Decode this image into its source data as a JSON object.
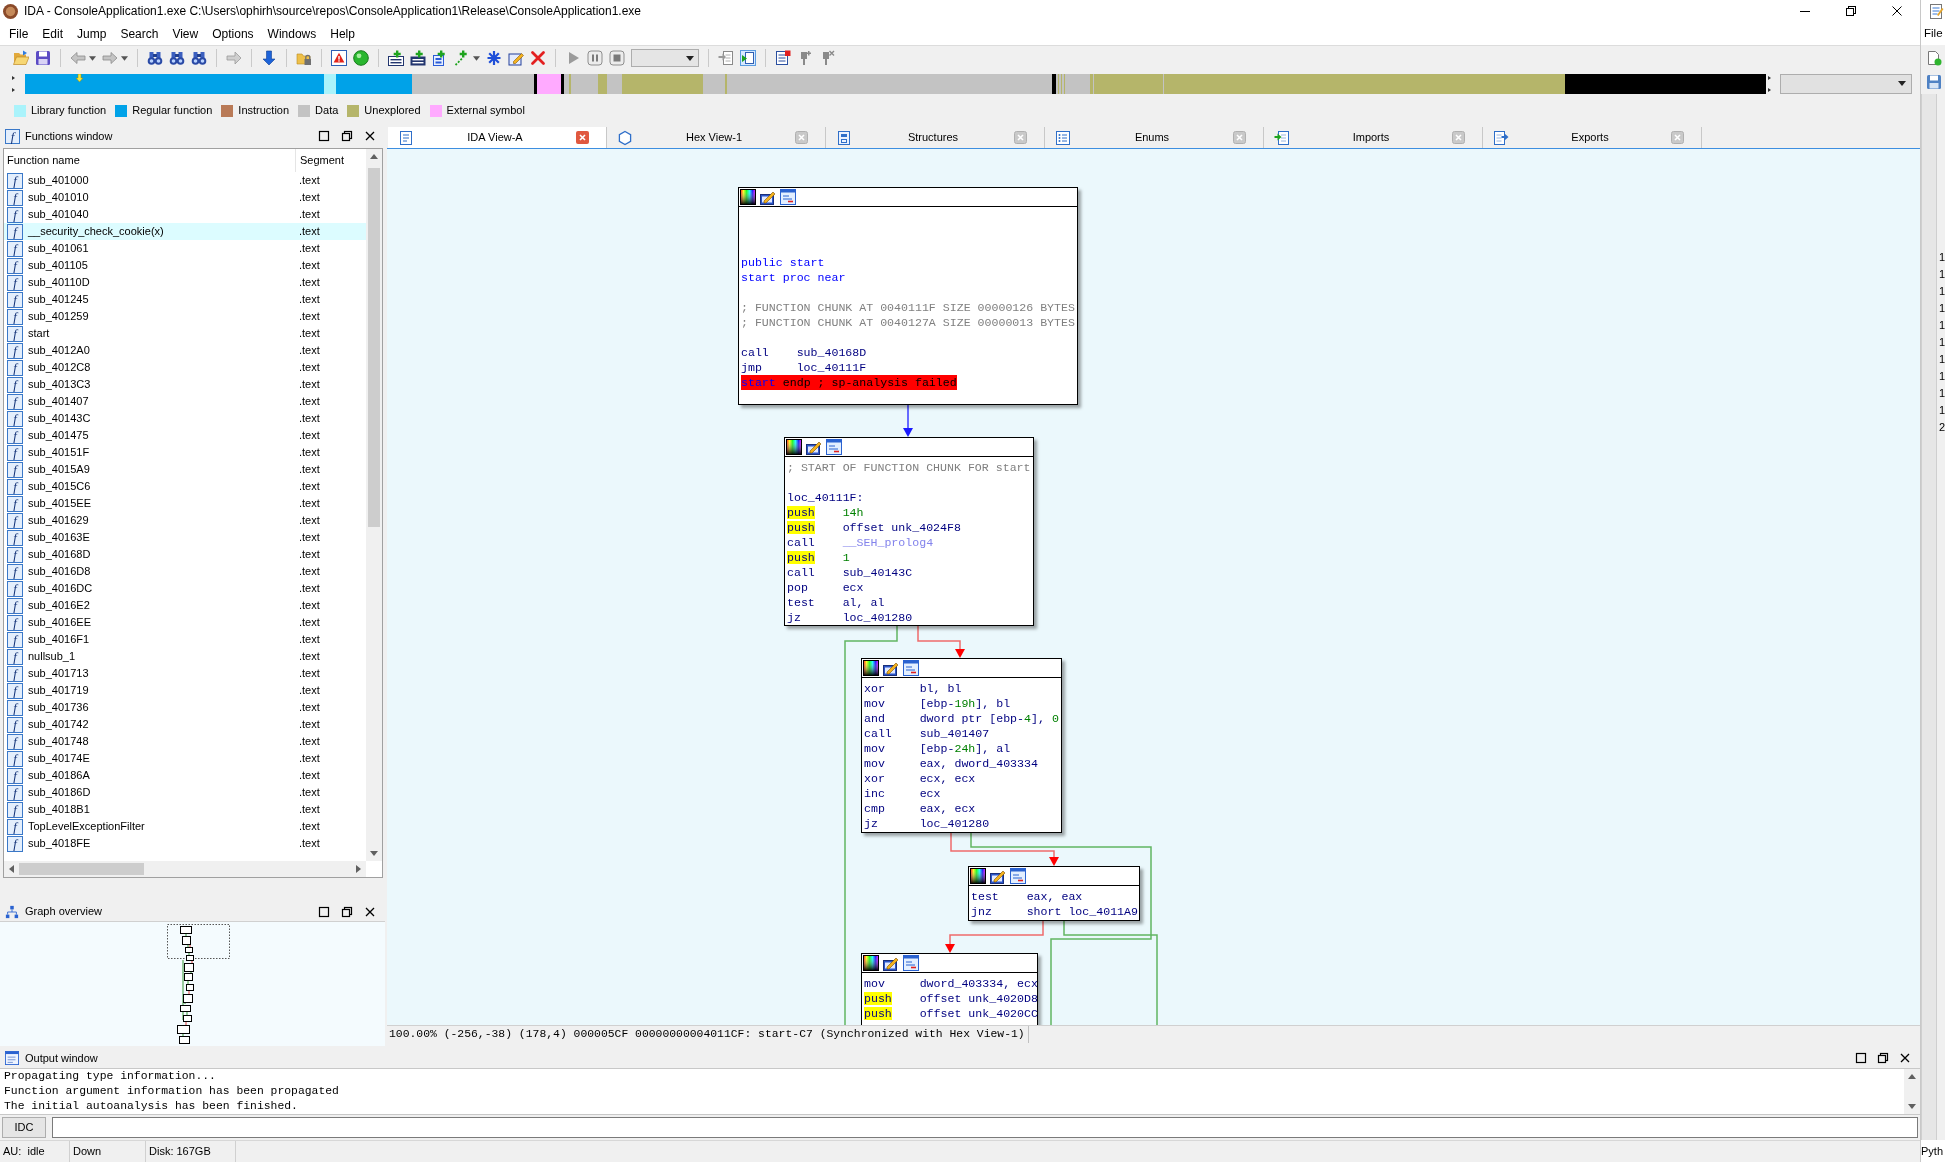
{
  "window": {
    "title": "IDA - ConsoleApplication1.exe C:\\Users\\ophirh\\source\\repos\\ConsoleApplication1\\Release\\ConsoleApplication1.exe"
  },
  "menu": [
    {
      "label": "File"
    },
    {
      "label": "Edit"
    },
    {
      "label": "Jump"
    },
    {
      "label": "Search"
    },
    {
      "label": "View"
    },
    {
      "label": "Options"
    },
    {
      "label": "Windows"
    },
    {
      "label": "Help"
    }
  ],
  "legend": [
    {
      "label": "Library function",
      "color": "#aaf3fb"
    },
    {
      "label": "Regular function",
      "color": "#00a2e8"
    },
    {
      "label": "Instruction",
      "color": "#b97a57"
    },
    {
      "label": "Data",
      "color": "#c3c3c3"
    },
    {
      "label": "Unexplored",
      "color": "#b5b56a"
    },
    {
      "label": "External symbol",
      "color": "#ffaaff"
    }
  ],
  "functions_window": {
    "title_icon": "f",
    "title": "Functions window",
    "columns": [
      "Function name",
      "Segment"
    ],
    "rows": [
      {
        "icon": "f",
        "name": "sub_401000",
        "segment": ".text",
        "kind": "regular"
      },
      {
        "icon": "f",
        "name": "sub_401010",
        "segment": ".text",
        "kind": "regular"
      },
      {
        "icon": "f",
        "name": "sub_401040",
        "segment": ".text",
        "kind": "regular"
      },
      {
        "icon": "f",
        "name": "__security_check_cookie(x)",
        "segment": ".text",
        "kind": "library"
      },
      {
        "icon": "f",
        "name": "sub_401061",
        "segment": ".text",
        "kind": "regular"
      },
      {
        "icon": "f",
        "name": "sub_401105",
        "segment": ".text",
        "kind": "regular"
      },
      {
        "icon": "f",
        "name": "sub_40110D",
        "segment": ".text",
        "kind": "regular"
      },
      {
        "icon": "f",
        "name": "sub_401245",
        "segment": ".text",
        "kind": "regular"
      },
      {
        "icon": "f",
        "name": "sub_401259",
        "segment": ".text",
        "kind": "regular"
      },
      {
        "icon": "f",
        "name": "start",
        "segment": ".text",
        "kind": "regular"
      },
      {
        "icon": "f",
        "name": "sub_4012A0",
        "segment": ".text",
        "kind": "regular"
      },
      {
        "icon": "f",
        "name": "sub_4012C8",
        "segment": ".text",
        "kind": "regular"
      },
      {
        "icon": "f",
        "name": "sub_4013C3",
        "segment": ".text",
        "kind": "regular"
      },
      {
        "icon": "f",
        "name": "sub_401407",
        "segment": ".text",
        "kind": "regular"
      },
      {
        "icon": "f",
        "name": "sub_40143C",
        "segment": ".text",
        "kind": "regular"
      },
      {
        "icon": "f",
        "name": "sub_401475",
        "segment": ".text",
        "kind": "regular"
      },
      {
        "icon": "f",
        "name": "sub_40151F",
        "segment": ".text",
        "kind": "regular"
      },
      {
        "icon": "f",
        "name": "sub_4015A9",
        "segment": ".text",
        "kind": "regular"
      },
      {
        "icon": "f",
        "name": "sub_4015C6",
        "segment": ".text",
        "kind": "regular"
      },
      {
        "icon": "f",
        "name": "sub_4015EE",
        "segment": ".text",
        "kind": "regular"
      },
      {
        "icon": "f",
        "name": "sub_401629",
        "segment": ".text",
        "kind": "regular"
      },
      {
        "icon": "f",
        "name": "sub_40163E",
        "segment": ".text",
        "kind": "regular"
      },
      {
        "icon": "f",
        "name": "sub_40168D",
        "segment": ".text",
        "kind": "regular"
      },
      {
        "icon": "f",
        "name": "sub_4016D8",
        "segment": ".text",
        "kind": "regular"
      },
      {
        "icon": "f",
        "name": "sub_4016DC",
        "segment": ".text",
        "kind": "regular"
      },
      {
        "icon": "f",
        "name": "sub_4016E2",
        "segment": ".text",
        "kind": "regular"
      },
      {
        "icon": "f",
        "name": "sub_4016EE",
        "segment": ".text",
        "kind": "regular"
      },
      {
        "icon": "f",
        "name": "sub_4016F1",
        "segment": ".text",
        "kind": "regular"
      },
      {
        "icon": "f",
        "name": "nullsub_1",
        "segment": ".text",
        "kind": "regular"
      },
      {
        "icon": "f",
        "name": "sub_401713",
        "segment": ".text",
        "kind": "regular"
      },
      {
        "icon": "f",
        "name": "sub_401719",
        "segment": ".text",
        "kind": "regular"
      },
      {
        "icon": "f",
        "name": "sub_401736",
        "segment": ".text",
        "kind": "regular"
      },
      {
        "icon": "f",
        "name": "sub_401742",
        "segment": ".text",
        "kind": "regular"
      },
      {
        "icon": "f",
        "name": "sub_401748",
        "segment": ".text",
        "kind": "regular"
      },
      {
        "icon": "f",
        "name": "sub_40174E",
        "segment": ".text",
        "kind": "regular"
      },
      {
        "icon": "f",
        "name": "sub_40186A",
        "segment": ".text",
        "kind": "regular"
      },
      {
        "icon": "f",
        "name": "sub_40186D",
        "segment": ".text",
        "kind": "regular"
      },
      {
        "icon": "f",
        "name": "sub_4018B1",
        "segment": ".text",
        "kind": "regular"
      },
      {
        "icon": "f",
        "name": "TopLevelExceptionFilter",
        "segment": ".text",
        "kind": "regular"
      },
      {
        "icon": "f",
        "name": "sub_4018FE",
        "segment": ".text",
        "kind": "regular"
      }
    ]
  },
  "graph_overview": {
    "title": "Graph overview"
  },
  "tabs": [
    {
      "label": "IDA View-A",
      "kind": "disassembly",
      "selected": true
    },
    {
      "label": "Hex View-1",
      "kind": "hex",
      "selected": false
    },
    {
      "label": "Structures",
      "kind": "structures",
      "selected": false
    },
    {
      "label": "Enums",
      "kind": "enums",
      "selected": false
    },
    {
      "label": "Imports",
      "kind": "imports",
      "selected": false
    },
    {
      "label": "Exports",
      "kind": "exports",
      "selected": false
    }
  ],
  "graph": {
    "nodes": [
      {
        "lines": [
          {
            "kind": "directive",
            "text": "public start"
          },
          {
            "kind": "directive",
            "text": "start proc near"
          },
          {
            "kind": "comment",
            "text": "; FUNCTION CHUNK AT 0040111F SIZE 00000126 BYTES"
          },
          {
            "kind": "comment",
            "text": "; FUNCTION CHUNK AT 0040127A SIZE 00000013 BYTES"
          },
          {
            "kind": "insn",
            "mnemonic": "call",
            "highlighted": false,
            "operands": [
              {
                "text": "sub_40168D",
                "kind": "plain"
              }
            ]
          },
          {
            "kind": "insn",
            "mnemonic": "jmp",
            "highlighted": false,
            "operands": [
              {
                "text": "loc_40111F",
                "kind": "plain"
              }
            ]
          },
          {
            "kind": "endp",
            "name": "start",
            "text": "endp ; sp-analysis failed",
            "error": true
          }
        ]
      },
      {
        "lines": [
          {
            "kind": "comment",
            "text": "; START OF FUNCTION CHUNK FOR start"
          },
          {
            "kind": "label",
            "text": "loc_40111F:"
          },
          {
            "kind": "insn",
            "mnemonic": "push",
            "highlighted": true,
            "operands": [
              {
                "text": "14h",
                "kind": "number"
              }
            ]
          },
          {
            "kind": "insn",
            "mnemonic": "push",
            "highlighted": true,
            "operands": [
              {
                "text": "offset unk_4024F8",
                "kind": "plain"
              }
            ]
          },
          {
            "kind": "insn",
            "mnemonic": "call",
            "highlighted": false,
            "operands": [
              {
                "text": "__SEH_prolog4",
                "kind": "library"
              }
            ]
          },
          {
            "kind": "insn",
            "mnemonic": "push",
            "highlighted": true,
            "operands": [
              {
                "text": "1",
                "kind": "number"
              }
            ]
          },
          {
            "kind": "insn",
            "mnemonic": "call",
            "highlighted": false,
            "operands": [
              {
                "text": "sub_40143C",
                "kind": "plain"
              }
            ]
          },
          {
            "kind": "insn",
            "mnemonic": "pop",
            "highlighted": false,
            "operands": [
              {
                "text": "ecx",
                "kind": "plain"
              }
            ]
          },
          {
            "kind": "insn",
            "mnemonic": "test",
            "highlighted": false,
            "operands": [
              {
                "text": "al, al",
                "kind": "plain"
              }
            ]
          },
          {
            "kind": "insn",
            "mnemonic": "jz",
            "highlighted": false,
            "operands": [
              {
                "text": "loc_401280",
                "kind": "plain"
              }
            ]
          }
        ]
      },
      {
        "lines": [
          {
            "kind": "insn",
            "mnemonic": "xor",
            "highlighted": false,
            "operands": [
              {
                "text": "bl, bl",
                "kind": "plain"
              }
            ]
          },
          {
            "kind": "insn",
            "mnemonic": "mov",
            "highlighted": false,
            "operands": [
              {
                "text": "[ebp-",
                "kind": "plain"
              },
              {
                "text": "19h",
                "kind": "number"
              },
              {
                "text": "], bl",
                "kind": "plain"
              }
            ]
          },
          {
            "kind": "insn",
            "mnemonic": "and",
            "highlighted": false,
            "operands": [
              {
                "text": "dword ptr [ebp-",
                "kind": "plain"
              },
              {
                "text": "4",
                "kind": "number"
              },
              {
                "text": "], ",
                "kind": "plain"
              },
              {
                "text": "0",
                "kind": "number"
              }
            ]
          },
          {
            "kind": "insn",
            "mnemonic": "call",
            "highlighted": false,
            "operands": [
              {
                "text": "sub_401407",
                "kind": "plain"
              }
            ]
          },
          {
            "kind": "insn",
            "mnemonic": "mov",
            "highlighted": false,
            "operands": [
              {
                "text": "[ebp-",
                "kind": "plain"
              },
              {
                "text": "24h",
                "kind": "number"
              },
              {
                "text": "], al",
                "kind": "plain"
              }
            ]
          },
          {
            "kind": "insn",
            "mnemonic": "mov",
            "highlighted": false,
            "operands": [
              {
                "text": "eax, dword_403334",
                "kind": "plain"
              }
            ]
          },
          {
            "kind": "insn",
            "mnemonic": "xor",
            "highlighted": false,
            "operands": [
              {
                "text": "ecx, ecx",
                "kind": "plain"
              }
            ]
          },
          {
            "kind": "insn",
            "mnemonic": "inc",
            "highlighted": false,
            "operands": [
              {
                "text": "ecx",
                "kind": "plain"
              }
            ]
          },
          {
            "kind": "insn",
            "mnemonic": "cmp",
            "highlighted": false,
            "operands": [
              {
                "text": "eax, ecx",
                "kind": "plain"
              }
            ]
          },
          {
            "kind": "insn",
            "mnemonic": "jz",
            "highlighted": false,
            "operands": [
              {
                "text": "loc_401280",
                "kind": "plain"
              }
            ]
          }
        ]
      },
      {
        "lines": [
          {
            "kind": "insn",
            "mnemonic": "test",
            "highlighted": false,
            "operands": [
              {
                "text": "eax, eax",
                "kind": "plain"
              }
            ]
          },
          {
            "kind": "insn",
            "mnemonic": "jnz",
            "highlighted": false,
            "operands": [
              {
                "text": "short loc_4011A9",
                "kind": "plain"
              }
            ]
          }
        ]
      },
      {
        "lines": [
          {
            "kind": "insn",
            "mnemonic": "mov",
            "highlighted": false,
            "operands": [
              {
                "text": "dword_403334, ecx",
                "kind": "plain"
              }
            ]
          },
          {
            "kind": "insn",
            "mnemonic": "push",
            "highlighted": true,
            "operands": [
              {
                "text": "offset unk_4020D8",
                "kind": "plain"
              }
            ]
          },
          {
            "kind": "insn",
            "mnemonic": "push",
            "highlighted": true,
            "operands": [
              {
                "text": "offset unk_4020CC",
                "kind": "plain"
              }
            ]
          }
        ]
      }
    ]
  },
  "view_status": "100.00% (-256,-38) (178,4) 000005CF 00000000004011CF: start-C7 (Synchronized with Hex View-1)",
  "output_window": {
    "title": "Output window",
    "lines": [
      "Propagating type information...",
      "Function argument information has been propagated",
      "The initial autoanalysis has been finished."
    ]
  },
  "command_line": {
    "language": "IDC"
  },
  "status_bar": [
    "AU:  idle",
    "Down",
    "Disk: 167GB"
  ],
  "background_window": {
    "menu": "File",
    "line_numbers": [
      "1",
      "1",
      "1",
      "1",
      "1",
      "1",
      "1",
      "1",
      "1",
      "1",
      "2"
    ],
    "status": "Pyth"
  }
}
